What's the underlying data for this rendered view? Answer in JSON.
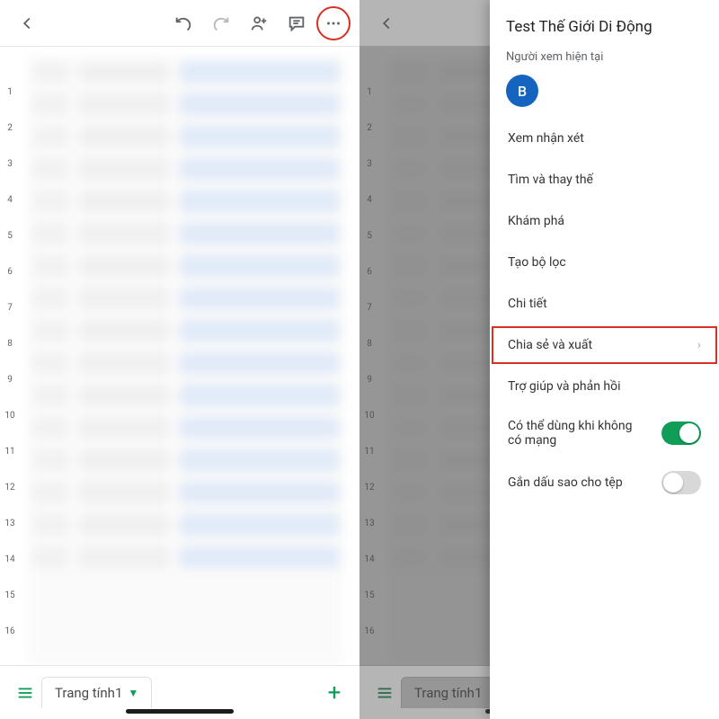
{
  "colors": {
    "accent_green": "#0f9d58",
    "highlight_red": "#d93025",
    "avatar_bg": "#1565c0"
  },
  "left": {
    "sheet_tab": "Trang tính1",
    "row_numbers": [
      1,
      2,
      3,
      4,
      5,
      6,
      7,
      8,
      9,
      10,
      11,
      12,
      13,
      14,
      15,
      16
    ]
  },
  "right": {
    "sheet_tab": "Trang tính1",
    "row_numbers": [
      1,
      2,
      3,
      4,
      5,
      6,
      7,
      8,
      9,
      10,
      11,
      12,
      13,
      14,
      15,
      16
    ],
    "panel": {
      "title": "Test Thế Giới Di Động",
      "viewers_label": "Người xem hiện tại",
      "avatar_initial": "B",
      "items": {
        "comments": "Xem nhận xét",
        "find_replace": "Tìm và thay thế",
        "explore": "Khám phá",
        "create_filter": "Tạo bộ lọc",
        "details": "Chi tiết",
        "share_export": "Chia sẻ và xuất",
        "help": "Trợ giúp và phản hồi"
      },
      "toggles": {
        "offline_label": "Có thể dùng khi không có mạng",
        "offline_on": true,
        "star_label": "Gắn dấu sao cho tệp",
        "star_on": false
      }
    }
  }
}
